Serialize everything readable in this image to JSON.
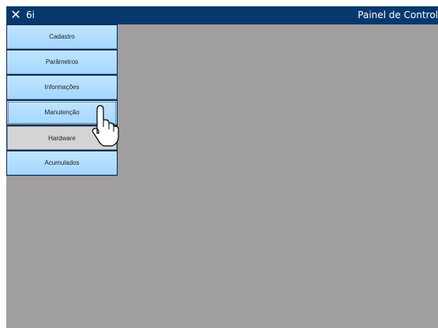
{
  "titlebar": {
    "close_icon": "close-icon",
    "close_glyph": "✕",
    "app_name": "6i",
    "window_title": "Painel de Control"
  },
  "menu": {
    "items": [
      {
        "label": "Cadastro"
      },
      {
        "label": "Parâmetros"
      },
      {
        "label": "Informações"
      },
      {
        "label": "Manutenção"
      },
      {
        "label": "Hardware"
      },
      {
        "label": "Acumulados"
      }
    ]
  },
  "colors": {
    "titlebar": "#06386e",
    "workspace": "#a19e9f",
    "menu_item": "#bfe5ff",
    "menu_selected": "#d4d4d4"
  },
  "cursor_icon": "hand-pointer-icon"
}
